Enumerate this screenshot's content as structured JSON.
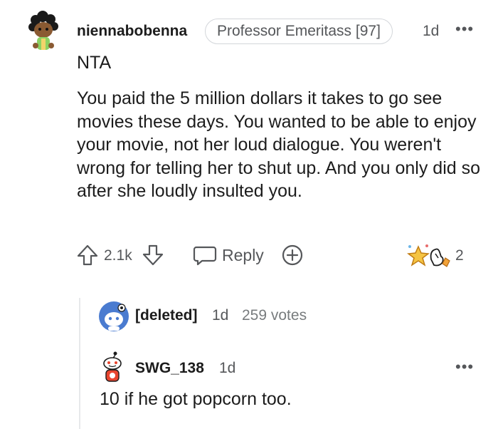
{
  "comment": {
    "username": "niennabobenna",
    "flair": "Professor Emeritass [97]",
    "time": "1d",
    "more": "•••",
    "verdict": "NTA",
    "body": "You paid the 5 million dollars it takes to go see movies these days. You wanted to be able to enjoy your movie, not her loud dialogue. You weren't wrong for telling her to shut up. And you only did so after she loudly insulted you.",
    "score": "2.1k",
    "reply_label": "Reply",
    "award_count": "2",
    "avatar_icon": "snoo-avatar-dreadlocks-icon"
  },
  "replies": [
    {
      "username": "[deleted]",
      "time": "1d",
      "votes": "259 votes",
      "avatar_icon": "deleted-user-avatar-icon"
    },
    {
      "username": "SWG_138",
      "time": "1d",
      "more": "•••",
      "body": "10 if he got popcorn too.",
      "avatar_icon": "snoo-avatar-icon"
    }
  ],
  "colors": {
    "text": "#1c1c1c",
    "meta": "#55575a",
    "border": "#d3d6da",
    "thread_line": "#e7e9eb",
    "deleted_avatar": "#4a7bd0"
  }
}
